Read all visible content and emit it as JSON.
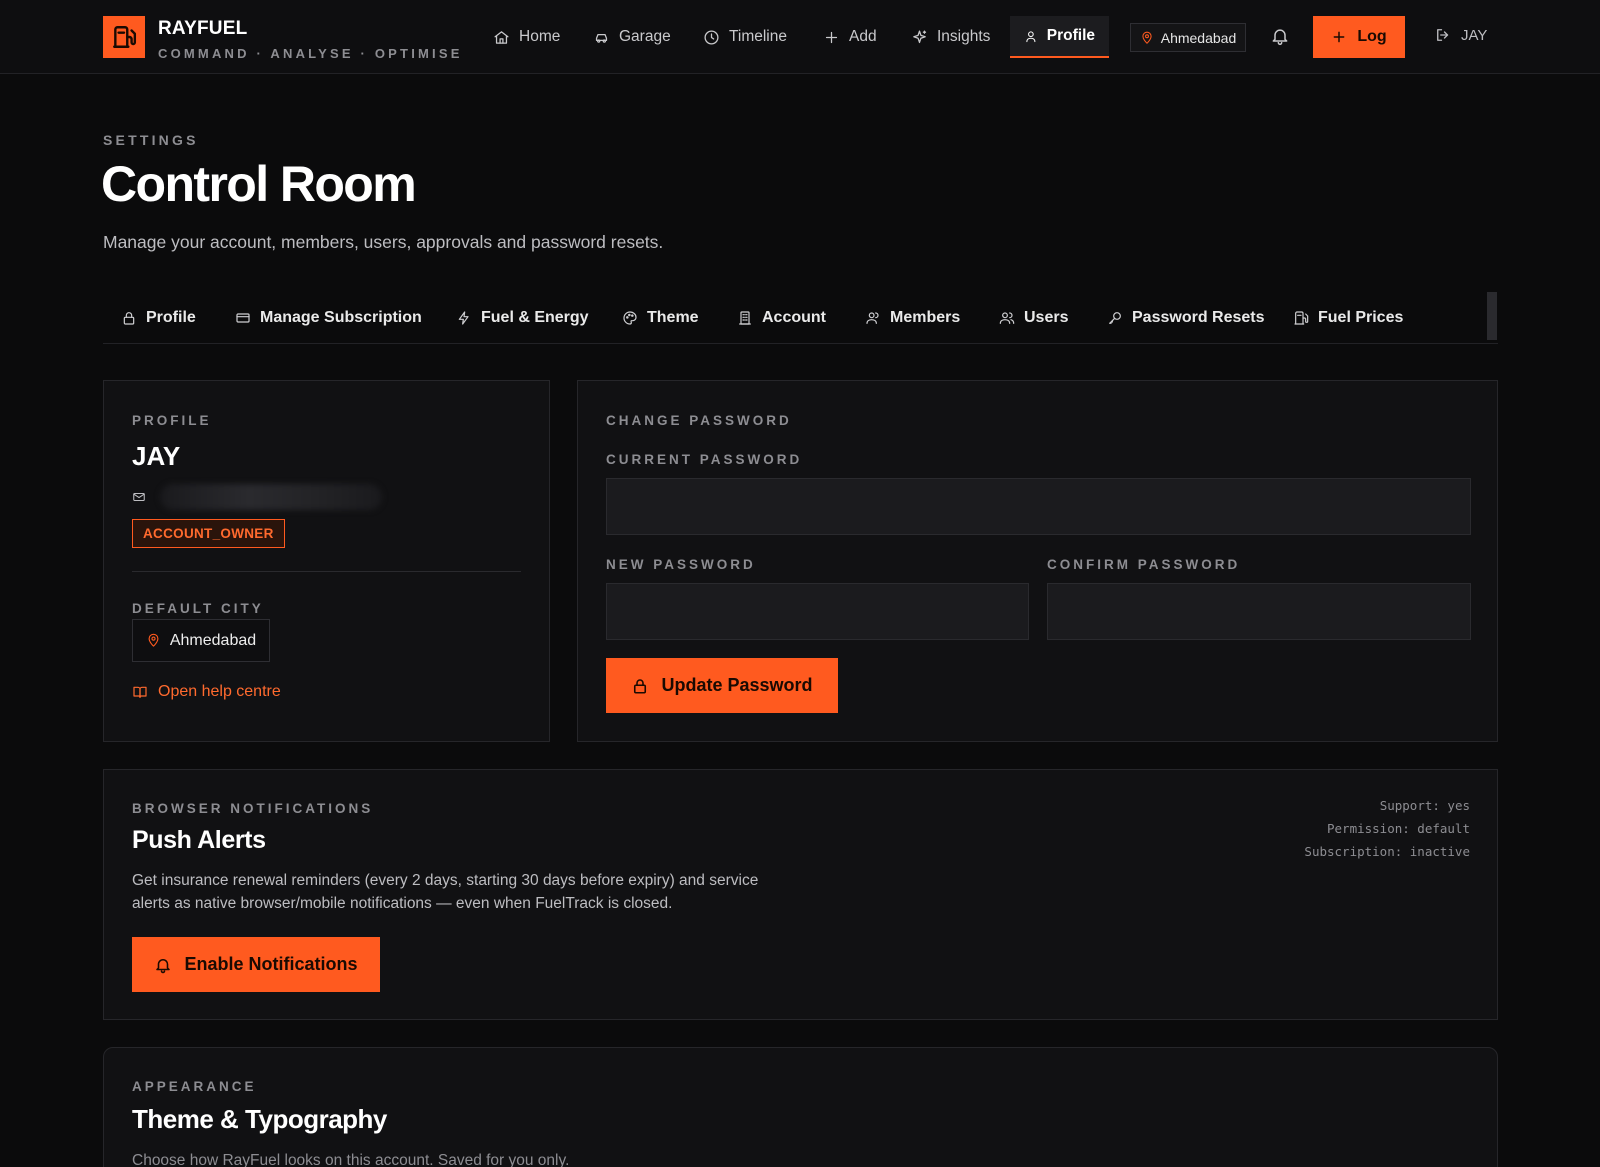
{
  "brand": {
    "name": "RAYFUEL",
    "tagline": "COMMAND · ANALYSE · OPTIMISE",
    "logo_icon": "fuel-pump-icon",
    "accent": "#ff5a1f"
  },
  "nav": {
    "items": [
      {
        "label": "Home",
        "icon": "home-icon"
      },
      {
        "label": "Garage",
        "icon": "car-icon"
      },
      {
        "label": "Timeline",
        "icon": "clock-icon"
      },
      {
        "label": "Add",
        "icon": "plus-icon"
      },
      {
        "label": "Insights",
        "icon": "sparkle-icon"
      },
      {
        "label": "Profile",
        "icon": "user-icon",
        "active": true
      }
    ],
    "city": "Ahmedabad",
    "log_label": "Log",
    "user": "JAY"
  },
  "page": {
    "eyebrow": "SETTINGS",
    "title": "Control Room",
    "subtitle": "Manage your account, members, users, approvals and password resets."
  },
  "tabs": [
    {
      "label": "Profile",
      "icon": "lock-icon"
    },
    {
      "label": "Manage Subscription",
      "icon": "credit-card-icon"
    },
    {
      "label": "Fuel & Energy",
      "icon": "bolt-icon"
    },
    {
      "label": "Theme",
      "icon": "palette-icon"
    },
    {
      "label": "Account",
      "icon": "building-icon"
    },
    {
      "label": "Members",
      "icon": "users-icon"
    },
    {
      "label": "Users",
      "icon": "users-icon"
    },
    {
      "label": "Password Resets",
      "icon": "key-icon"
    },
    {
      "label": "Fuel Prices",
      "icon": "fuel-pump-icon"
    }
  ],
  "profile": {
    "eyebrow": "PROFILE",
    "name": "JAY",
    "role": "ACCOUNT_OWNER",
    "city_label": "DEFAULT CITY",
    "city": "Ahmedabad",
    "help_link": "Open help centre"
  },
  "password": {
    "eyebrow": "CHANGE PASSWORD",
    "current_label": "CURRENT PASSWORD",
    "current_value": "",
    "new_label": "NEW PASSWORD",
    "new_value": "",
    "confirm_label": "CONFIRM PASSWORD",
    "confirm_value": "",
    "button": "Update Password"
  },
  "notifications": {
    "eyebrow": "BROWSER NOTIFICATIONS",
    "title": "Push Alerts",
    "description": "Get insurance renewal reminders (every 2 days, starting 30 days before expiry) and service alerts as native browser/mobile notifications — even when FuelTrack is closed.",
    "button": "Enable Notifications",
    "support": "Support: yes",
    "permission": "Permission: default",
    "subscription": "Subscription: inactive"
  },
  "appearance": {
    "eyebrow": "APPEARANCE",
    "title": "Theme & Typography",
    "description": "Choose how RayFuel looks on this account. Saved for you only."
  }
}
